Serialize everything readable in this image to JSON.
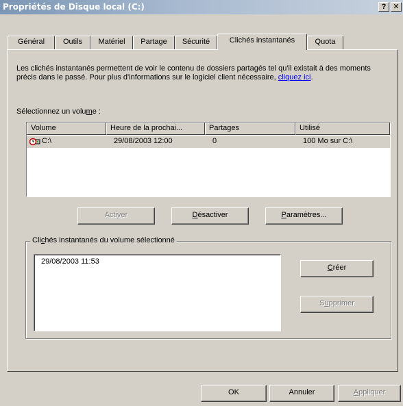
{
  "window": {
    "title": "Propriétés de Disque local (C:)",
    "help_label": "?",
    "close_label": "✕"
  },
  "tabs": [
    {
      "label": "Général"
    },
    {
      "label": "Outils"
    },
    {
      "label": "Matériel"
    },
    {
      "label": "Partage"
    },
    {
      "label": "Sécurité"
    },
    {
      "label": "Clichés instantanés",
      "active": true
    },
    {
      "label": "Quota"
    }
  ],
  "description": {
    "text": "Les clichés instantanés permettent de voir le contenu de dossiers partagés tel qu'il existait à des moments précis dans le passé. Pour plus d'informations sur le logiciel client nécessaire, ",
    "link": "cliquez ici",
    "end": "."
  },
  "volume_list": {
    "label_before": "Sélectionnez un volu",
    "label_mnemonic": "m",
    "label_after": "e :",
    "columns": [
      "Volume",
      "Heure de la prochai...",
      "Partages",
      "Utilisé"
    ],
    "rows": [
      {
        "volume": "C:\\",
        "next_time": "29/08/2003 12:00",
        "shares": "0",
        "used": "100 Mo sur C:\\",
        "icon": "clock-disk-icon"
      }
    ]
  },
  "buttons": {
    "activate": {
      "before": "Acti",
      "mnemonic": "v",
      "after": "er",
      "enabled": false
    },
    "deactivate": {
      "before": "",
      "mnemonic": "D",
      "after": "ésactiver"
    },
    "settings": {
      "before": "",
      "mnemonic": "P",
      "after": "aramètres..."
    },
    "create": {
      "before": "",
      "mnemonic": "C",
      "after": "réer"
    },
    "delete": {
      "before": "S",
      "mnemonic": "u",
      "after": "pprimer",
      "enabled": false
    },
    "ok": "OK",
    "cancel": "Annuler",
    "apply": {
      "before": "",
      "mnemonic": "A",
      "after": "ppliquer",
      "enabled": false
    }
  },
  "snapshots": {
    "group_before": "Cli",
    "group_mnemonic": "c",
    "group_after": "hés instantanés du volume sélectionné",
    "items": [
      "29/08/2003 11:53"
    ]
  }
}
